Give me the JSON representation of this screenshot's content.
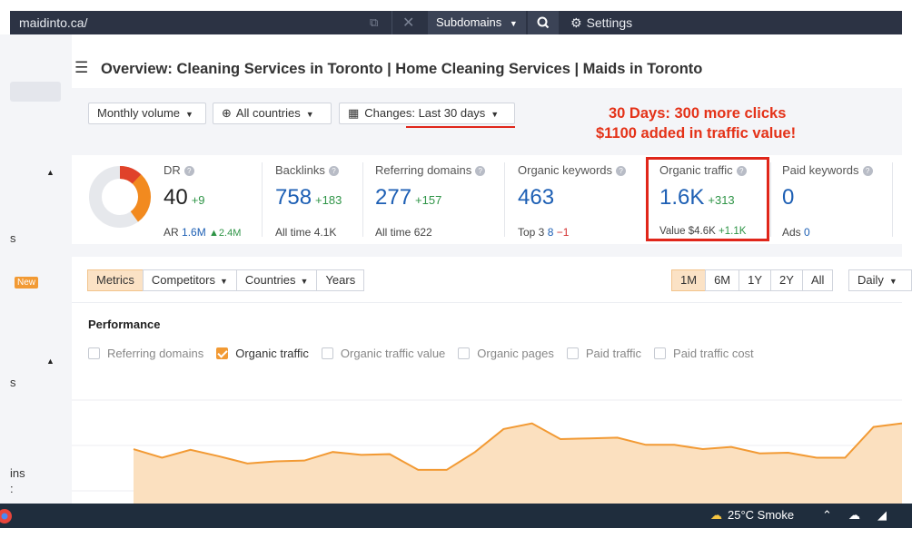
{
  "topbar": {
    "url": "maidinto.ca/",
    "subdomains_label": "Subdomains",
    "settings_label": "Settings"
  },
  "sidebar": {
    "frag_1": "s",
    "new_badge": "New",
    "frag_2": "s",
    "frag_3": "ins",
    "frag_4": ":"
  },
  "header": {
    "title": "Overview: Cleaning Services in Toronto | Home Cleaning Services | Maids in Toronto"
  },
  "filters": {
    "volume": "Monthly volume",
    "countries": "All countries",
    "changes_prefix": "Changes:",
    "changes_value": "Last 30 days"
  },
  "annotation": {
    "line1": "30 Days: 300 more clicks",
    "line2": "$1100 added in traffic value!"
  },
  "metrics": {
    "dr": {
      "label": "DR",
      "value": "40",
      "delta": "+9",
      "ar_label": "AR",
      "ar_value": "1.6M",
      "ar_delta": "▲2.4M",
      "fill_fraction": 0.4
    },
    "backlinks": {
      "label": "Backlinks",
      "value": "758",
      "delta": "+183",
      "sub_label": "All time",
      "sub_value": "4.1K"
    },
    "refdomains": {
      "label": "Referring domains",
      "value": "277",
      "delta": "+157",
      "sub_label": "All time",
      "sub_value": "622"
    },
    "organic_keywords": {
      "label": "Organic keywords",
      "value": "463",
      "sub_label": "Top 3",
      "sub_value": "8",
      "sub_delta": "−1"
    },
    "organic_traffic": {
      "label": "Organic traffic",
      "value": "1.6K",
      "delta": "+313",
      "sub_label": "Value",
      "sub_value": "$4.6K",
      "sub_delta": "+1.1K"
    },
    "paid_keywords": {
      "label": "Paid keywords",
      "value": "0",
      "sub_label": "Ads",
      "sub_value": "0"
    }
  },
  "panel": {
    "tabs": [
      "Metrics",
      "Competitors",
      "Countries",
      "Years"
    ],
    "ranges": [
      "1M",
      "6M",
      "1Y",
      "2Y",
      "All"
    ],
    "interval": "Daily",
    "performance_title": "Performance",
    "checkboxes": [
      {
        "label": "Referring domains",
        "checked": false
      },
      {
        "label": "Organic traffic",
        "checked": true
      },
      {
        "label": "Organic traffic value",
        "checked": false
      },
      {
        "label": "Organic pages",
        "checked": false
      },
      {
        "label": "Paid traffic",
        "checked": false
      },
      {
        "label": "Paid traffic cost",
        "checked": false
      }
    ]
  },
  "chart_data": {
    "type": "area",
    "series": [
      {
        "name": "Organic traffic",
        "color": "#f29a34",
        "values": [
          1380,
          1320,
          1375,
          1330,
          1280,
          1295,
          1300,
          1360,
          1340,
          1345,
          1235,
          1235,
          1360,
          1520,
          1560,
          1450,
          1455,
          1460,
          1410,
          1410,
          1380,
          1395,
          1350,
          1355,
          1320,
          1320,
          1535,
          1560
        ]
      }
    ],
    "ylim": [
      1000,
      1900
    ],
    "grid": true
  },
  "taskbar": {
    "weather": "25°C  Smoke"
  },
  "colors": {
    "accent": "#f29a34",
    "annotation_red": "#e43218",
    "link_blue": "#1d5fb4",
    "positive_green": "#2e9446"
  }
}
